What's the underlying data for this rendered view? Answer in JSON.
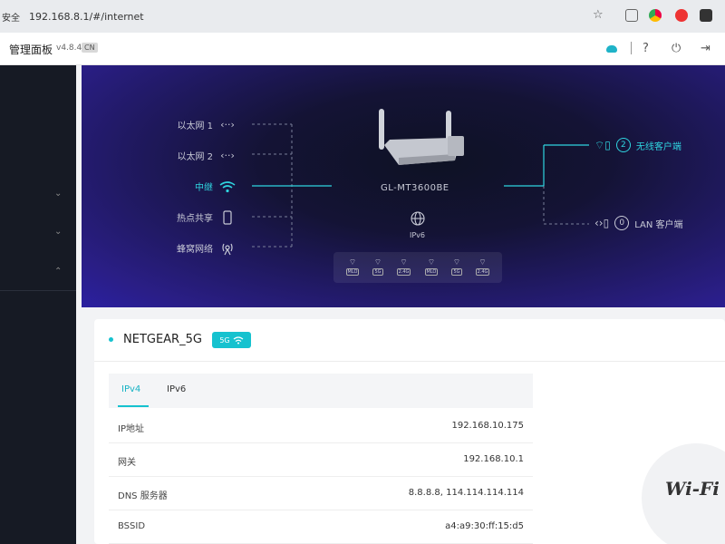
{
  "browser": {
    "security_label": "安全",
    "url": "192.168.8.1/#/internet"
  },
  "header": {
    "title": "管理面板",
    "version": "v4.8.4",
    "language": "CN"
  },
  "topology": {
    "sources": [
      {
        "label": "以太网 1",
        "icon": "ethernet-icon",
        "active": false
      },
      {
        "label": "以太网 2",
        "icon": "ethernet-icon",
        "active": false
      },
      {
        "label": "中继",
        "icon": "wifi-icon",
        "active": true
      },
      {
        "label": "热点共享",
        "icon": "phone-icon",
        "active": false
      },
      {
        "label": "蜂窝网络",
        "icon": "cellular-icon",
        "active": false
      }
    ],
    "router_model": "GL-MT3600BE",
    "ipv6_label": "IPv6",
    "bands": [
      "MLO",
      "5G",
      "2.4G",
      "MLO",
      "5G",
      "2.4G"
    ],
    "clients": [
      {
        "count": "2",
        "label": "无线客户端",
        "active": true
      },
      {
        "count": "0",
        "label": "LAN 客户端",
        "active": false
      }
    ]
  },
  "network": {
    "ssid": "NETGEAR_5G",
    "band_badge": "5G",
    "tabs": [
      "IPv4",
      "IPv6"
    ],
    "active_tab": "IPv4",
    "rows": [
      {
        "key": "IP地址",
        "value": "192.168.10.175"
      },
      {
        "key": "网关",
        "value": "192.168.10.1"
      },
      {
        "key": "DNS 服务器",
        "value": "8.8.8.8, 114.114.114.114"
      },
      {
        "key": "BSSID",
        "value": "a4:a9:30:ff:15:d5"
      }
    ]
  },
  "logo_text": "Wi-Fi",
  "colors": {
    "accent": "#16c2cf",
    "sidebar": "#161a24",
    "banner": "#2a1e86"
  }
}
